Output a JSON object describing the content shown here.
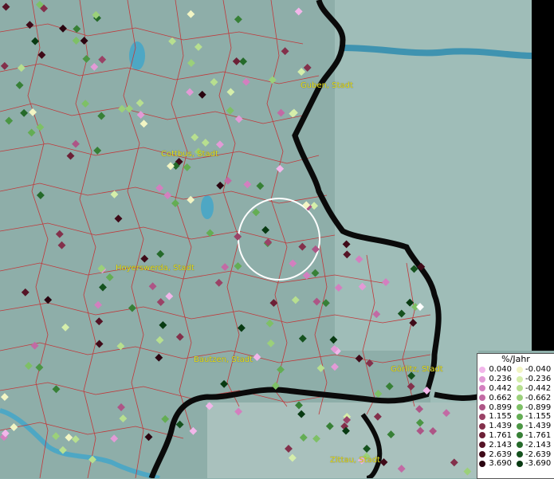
{
  "map": {
    "cities": [
      {
        "id": "guben",
        "name": "Guben, Stadt"
      },
      {
        "id": "cottbus",
        "name": "Cottbus, Stadt"
      },
      {
        "id": "hoyerswerda",
        "name": "Hoyerswerda, Stadt"
      },
      {
        "id": "bautzen",
        "name": "Bautzen, Stadt"
      },
      {
        "id": "goerlitz",
        "name": "Görlitz, Stadt"
      },
      {
        "id": "zittau",
        "name": "Zittau, Stadt"
      }
    ]
  },
  "legend": {
    "title": "%/Jahr",
    "positive": [
      "0.040",
      "0.236",
      "0.442",
      "0.662",
      "0.899",
      "1.155",
      "1.439",
      "1.761",
      "2.143",
      "2.639",
      "3.690"
    ],
    "negative": [
      "-0.040",
      "-0.236",
      "-0.442",
      "-0.662",
      "-0.899",
      "-1.155",
      "-1.439",
      "-1.761",
      "-2.143",
      "-2.639",
      "-3.690"
    ],
    "positive_colors": [
      "#f2b6ea",
      "#e29ad6",
      "#d37fbf",
      "#c26aa4",
      "#ad5586",
      "#9a4266",
      "#83304b",
      "#6c2036",
      "#551426",
      "#3f0a18",
      "#2a0510"
    ],
    "negative_colors": [
      "#f2f5c4",
      "#d5eeaa",
      "#b7df8f",
      "#9bd07a",
      "#7ec066",
      "#64ad54",
      "#4b9644",
      "#378036",
      "#256a2a",
      "#15521e",
      "#083a12"
    ]
  }
}
